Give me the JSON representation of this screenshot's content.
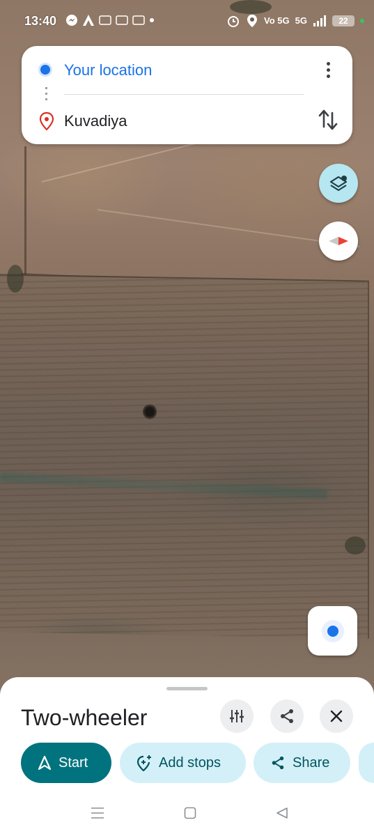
{
  "status_bar": {
    "time": "13:40",
    "left_icons": [
      "messenger-icon",
      "a-app-icon",
      "news-icon",
      "news-icon",
      "news-icon",
      "dot-icon"
    ],
    "signal_label": "5G",
    "network_label": "Vo 5G",
    "battery": "22"
  },
  "route": {
    "origin": "Your location",
    "destination": "Kuvadiya"
  },
  "sheet": {
    "mode": "Two-wheeler",
    "buttons": {
      "start": "Start",
      "add_stops": "Add stops",
      "share": "Share"
    }
  },
  "colors": {
    "primary_blue": "#1a73e8",
    "start_teal": "#00737f",
    "chip_bg": "#d3f0f8",
    "layers_bg": "#b6e6f0",
    "pin_red": "#d93025"
  }
}
